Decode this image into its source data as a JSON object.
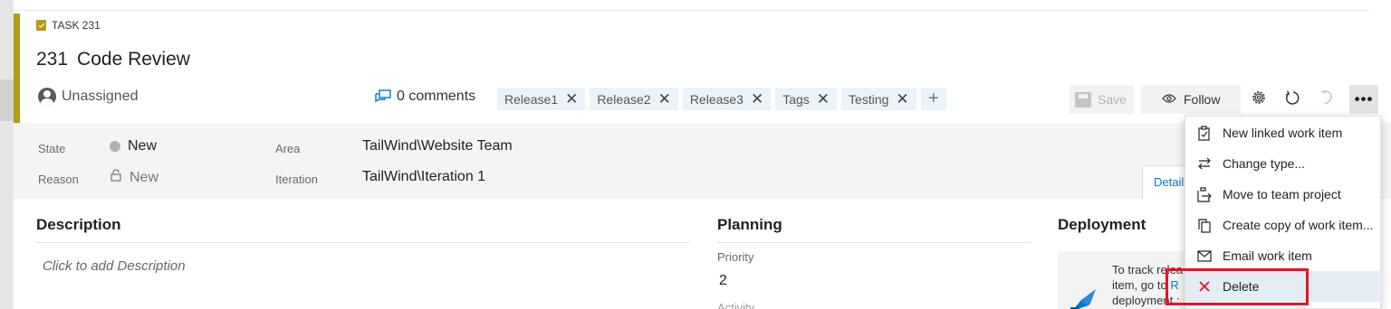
{
  "header": {
    "task_label": "TASK 231",
    "id": "231",
    "title": "Code Review",
    "assignee": "Unassigned",
    "comments": "0 comments"
  },
  "tags": [
    "Release1",
    "Release2",
    "Release3",
    "Tags",
    "Testing"
  ],
  "toolbar": {
    "save_label": "Save",
    "follow_label": "Follow"
  },
  "fields": {
    "state_label": "State",
    "state_value": "New",
    "reason_label": "Reason",
    "reason_value": "New",
    "area_label": "Area",
    "area_value": "TailWind\\Website Team",
    "iteration_label": "Iteration",
    "iteration_value": "TailWind\\Iteration 1"
  },
  "tabs": {
    "details": "Detail"
  },
  "sections": {
    "description_title": "Description",
    "description_placeholder": "Click to add Description",
    "planning_title": "Planning",
    "priority_label": "Priority",
    "priority_value": "2",
    "activity_label": "Activity",
    "deployment_title": "Deployment",
    "deployment_line1": "To track relea",
    "deployment_line2a": "item, go to ",
    "deployment_line2b": "R",
    "deployment_line3": "deployment :"
  },
  "menu": {
    "items": [
      {
        "label": "New linked work item",
        "icon": "new-linked-icon"
      },
      {
        "label": "Change type...",
        "icon": "change-type-icon"
      },
      {
        "label": "Move to team project",
        "icon": "move-icon"
      },
      {
        "label": "Create copy of work item...",
        "icon": "copy-icon"
      },
      {
        "label": "Email work item",
        "icon": "email-icon"
      },
      {
        "label": "Delete",
        "icon": "delete-icon"
      }
    ]
  },
  "colors": {
    "accent": "#b59a14",
    "link": "#0078d4",
    "highlight_box": "#e8141e",
    "delete_icon": "#e81123"
  }
}
